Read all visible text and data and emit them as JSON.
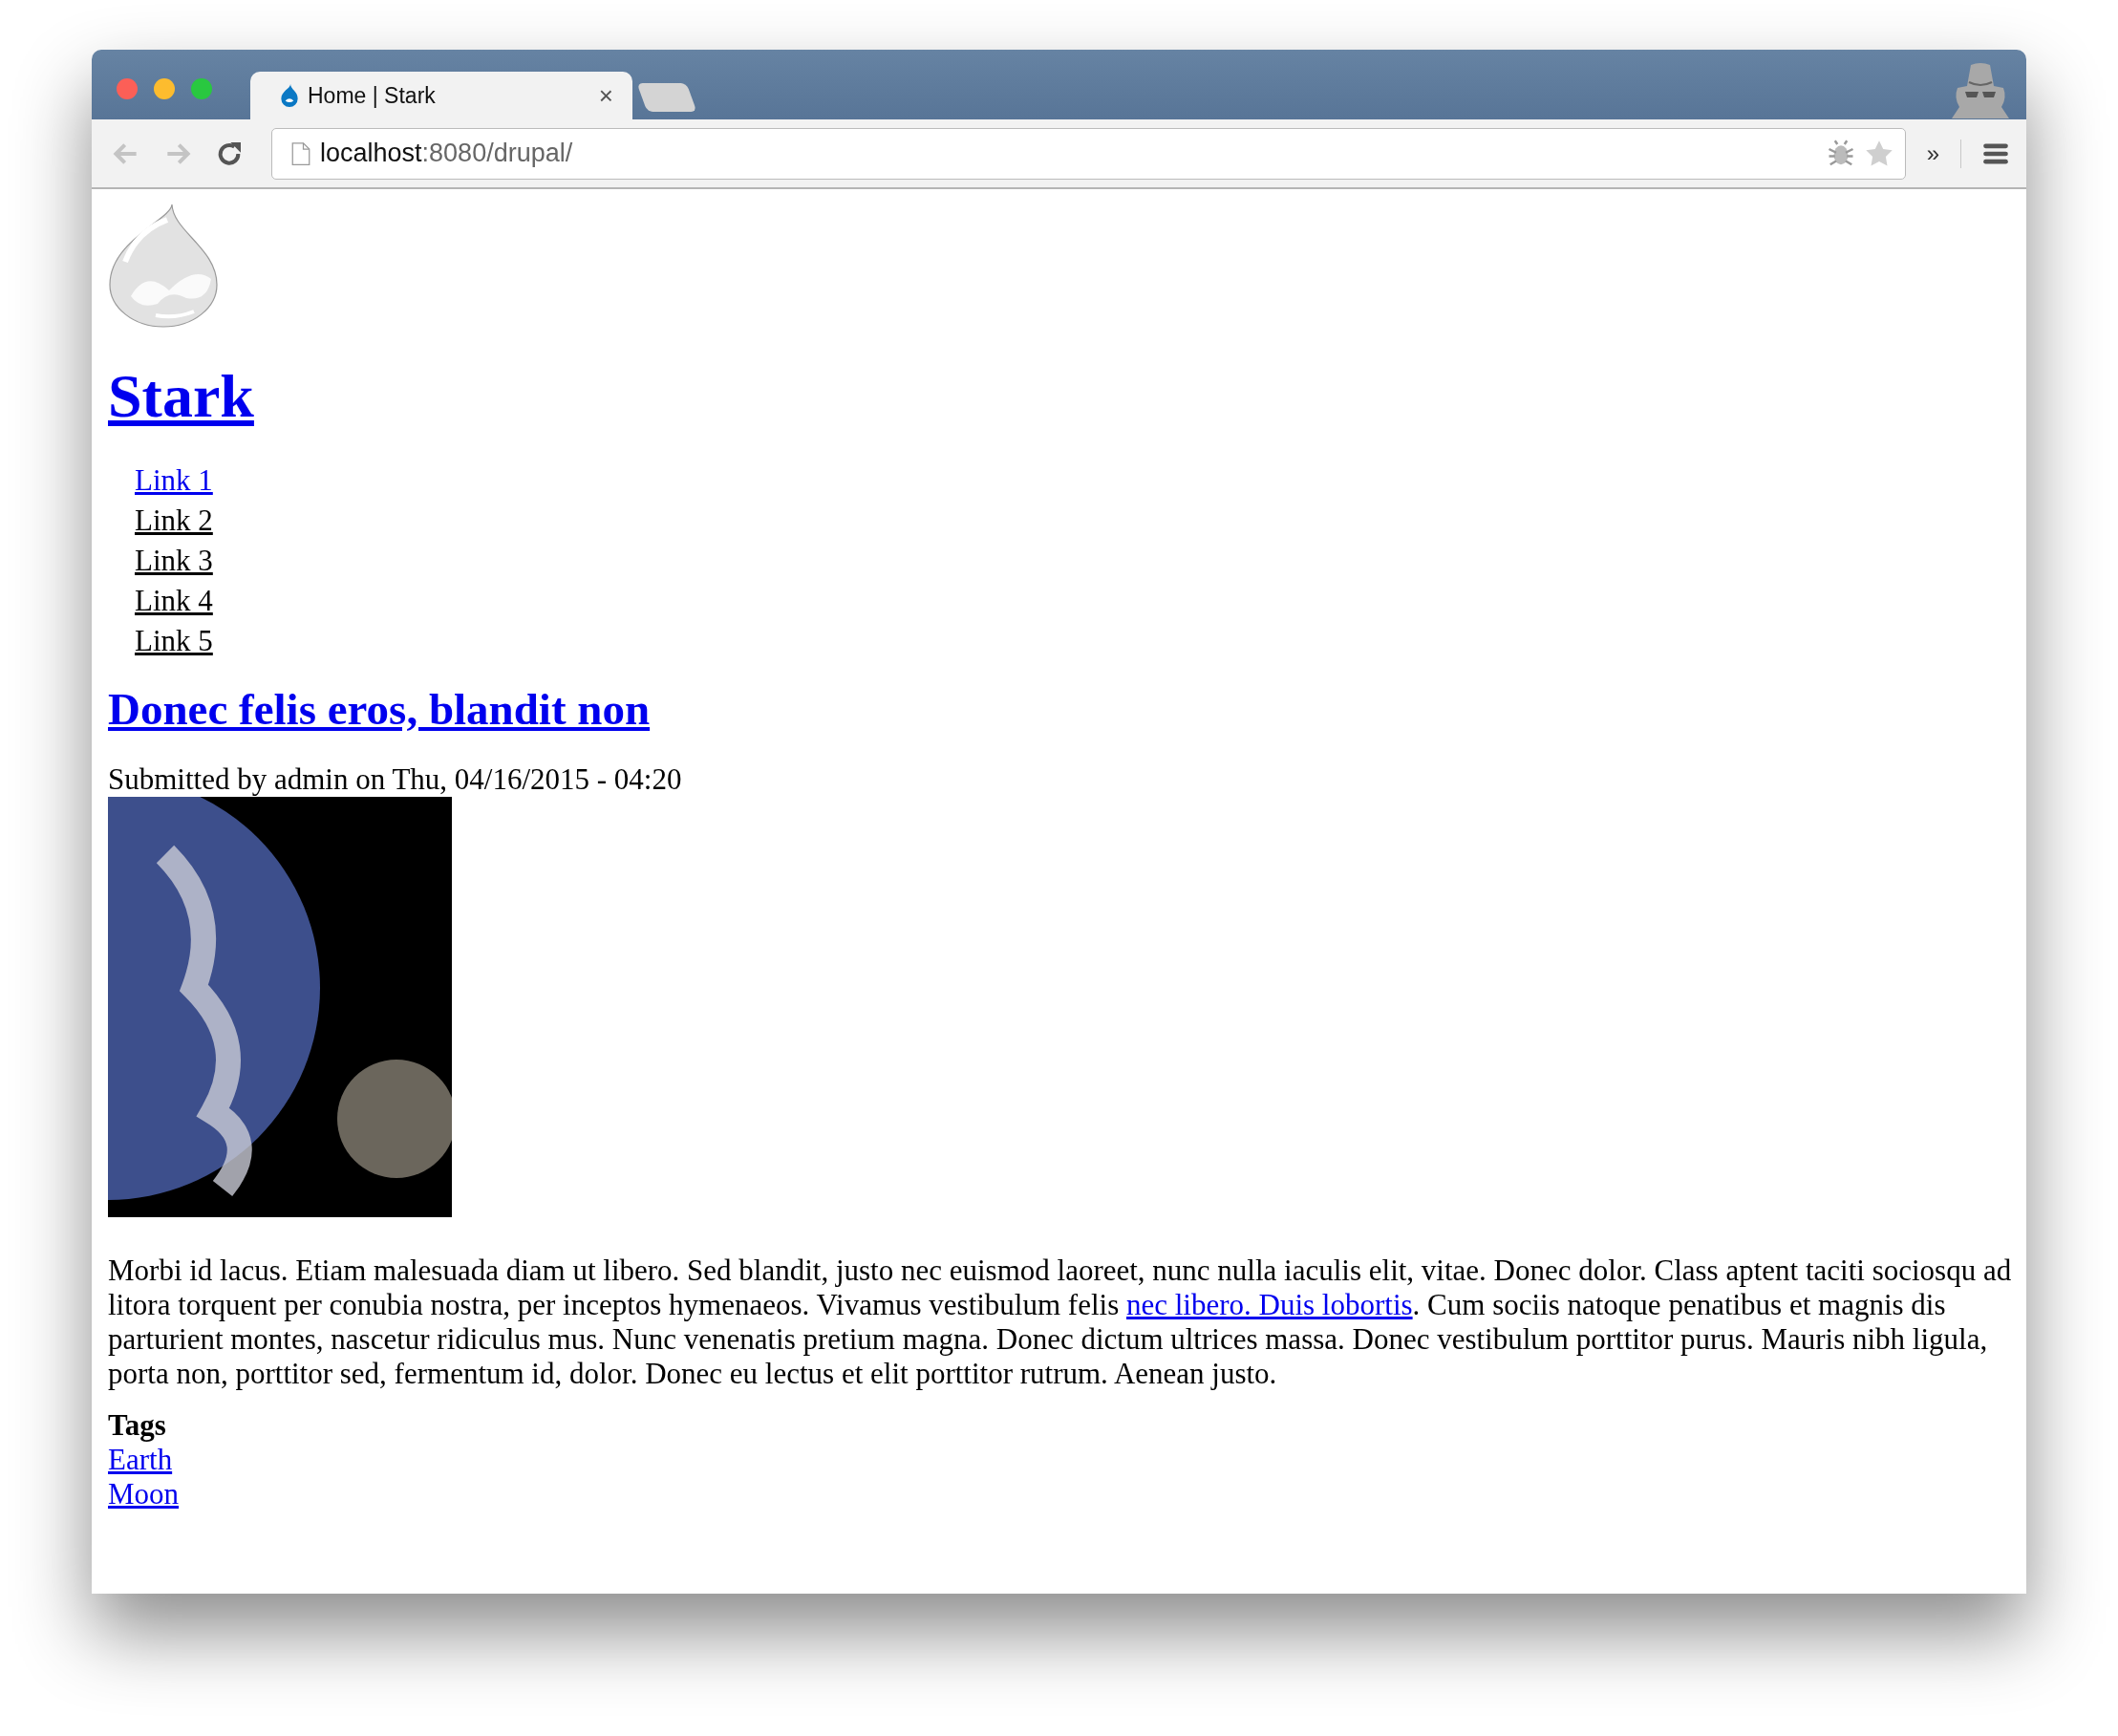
{
  "browser": {
    "tab": {
      "title": "Home | Stark",
      "close": "×"
    },
    "address": {
      "host": "localhost",
      "path": ":8080/drupal/"
    },
    "overflow": "»"
  },
  "site": {
    "name": "Stark"
  },
  "nav": [
    {
      "label": "Link 1",
      "active": true
    },
    {
      "label": "Link 2",
      "active": false
    },
    {
      "label": "Link 3",
      "active": false
    },
    {
      "label": "Link 4",
      "active": false
    },
    {
      "label": "Link 5",
      "active": false
    }
  ],
  "article": {
    "title": "Donec felis eros, blandit non",
    "meta": "Submitted by admin on Thu, 04/16/2015 - 04:20",
    "body": {
      "before": "Morbi id lacus. Etiam malesuada diam ut libero. Sed blandit, justo nec euismod laoreet, nunc nulla iaculis elit, vitae. Donec dolor. Class aptent taciti sociosqu ad litora torquent per conubia nostra, per inceptos hymenaeos. Vivamus vestibulum felis ",
      "link": "nec libero. Duis lobortis",
      "after": ". Cum sociis natoque penatibus et magnis dis parturient montes, nascetur ridiculus mus. Nunc venenatis pretium magna. Donec dictum ultrices massa. Donec vestibulum porttitor purus. Mauris nibh ligula, porta non, porttitor sed, fermentum id, dolor. Donec eu lectus et elit porttitor rutrum. Aenean justo."
    },
    "tags": {
      "label": "Tags",
      "items": [
        "Earth",
        "Moon"
      ]
    }
  }
}
